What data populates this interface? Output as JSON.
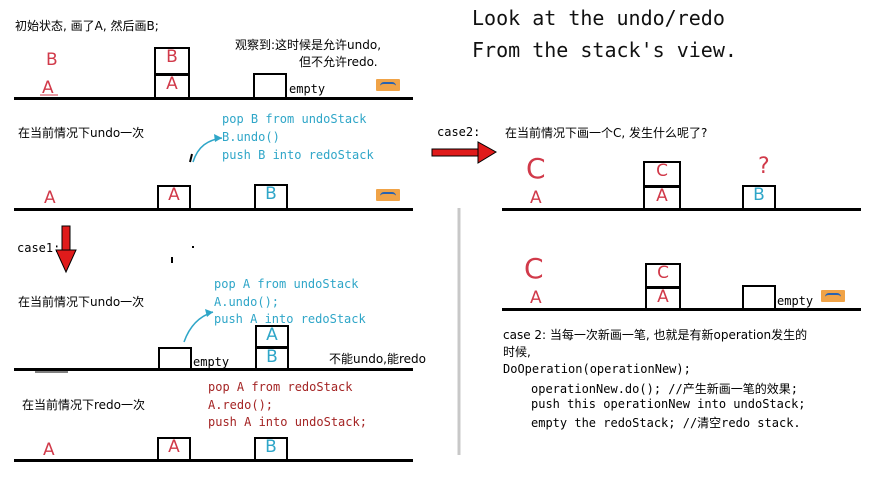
{
  "title": {
    "line1": "Look at the undo/redo",
    "line2": "From the stack's view."
  },
  "colors": {
    "blue_code": "#2fa6c8",
    "red_code": "#a42424",
    "hand_red": "#d13a4a",
    "arrow_red": "#e01b1b"
  },
  "section1": {
    "heading": "初始状态, 画了A, 然后画B;",
    "observe_line1": "观察到:这时候是允许undo,",
    "observe_line2": "但不允许redo.",
    "canvas_a": "A",
    "canvas_b": "B",
    "undo_stack": [
      "A",
      "B"
    ],
    "redo_label": "empty"
  },
  "section2": {
    "heading": "在当前情况下undo一次",
    "code": [
      "pop B from undoStack",
      "B.undo()",
      "push B into redoStack"
    ],
    "canvas_a": "A",
    "undo_stack": [
      "A"
    ],
    "redo_stack": [
      "B"
    ]
  },
  "case1": {
    "label": "case1:",
    "heading": "在当前情况下undo一次",
    "code": [
      "pop A from undoStack",
      "A.undo();",
      "push A into redoStack"
    ],
    "undo_label": "empty",
    "redo_stack": [
      "B",
      "A"
    ],
    "note": "不能undo,能redo"
  },
  "redo_section": {
    "heading": "在当前情况下redo一次",
    "code": [
      "pop A from redoStack",
      "A.redo();",
      "push A into undoStack;"
    ],
    "canvas_a": "A",
    "undo_stack": [
      "A"
    ],
    "redo_stack": [
      "B"
    ]
  },
  "case2": {
    "label": "case2:",
    "heading": "在当前情况下画一个C, 发生什么呢了?",
    "canvas_c": "C",
    "canvas_a": "A",
    "undo_stack": [
      "A",
      "C"
    ],
    "redo_stack": [
      "B"
    ],
    "question": "?",
    "after": {
      "canvas_c": "C",
      "canvas_a": "A",
      "undo_stack": [
        "A",
        "C"
      ],
      "redo_label": "empty"
    },
    "desc_line1": "case 2: 当每一次新画一笔, 也就是有新operation发生的",
    "desc_line2": "时候,",
    "code": [
      "DoOperation(operationNew);",
      "operationNew.do();   //产生新画一笔的效果;",
      "push this operationNew into undoStack;",
      "empty the redoStack; //清空redo stack."
    ]
  }
}
